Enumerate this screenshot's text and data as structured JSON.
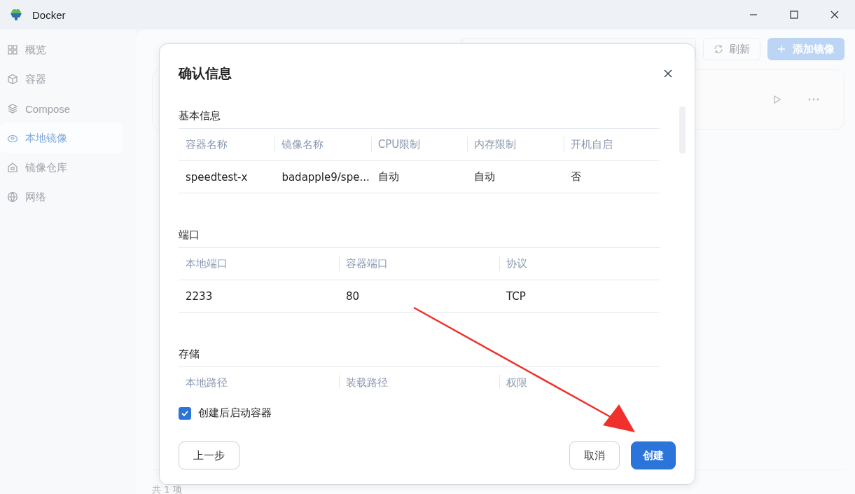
{
  "window": {
    "title": "Docker"
  },
  "sidebar": {
    "items": [
      {
        "label": "概览",
        "selected": false
      },
      {
        "label": "容器",
        "selected": false
      },
      {
        "label": "Compose",
        "selected": false
      },
      {
        "label": "本地镜像",
        "selected": true
      },
      {
        "label": "镜像仓库",
        "selected": false
      },
      {
        "label": "网络",
        "selected": false
      }
    ]
  },
  "toolbar": {
    "refresh": "刷新",
    "add": "添加镜像"
  },
  "footer": {
    "count": "共 1 项"
  },
  "dialog": {
    "title": "确认信息",
    "sections": [
      {
        "title": "基本信息",
        "columns": [
          "容器名称",
          "镜像名称",
          "CPU限制",
          "内存限制",
          "开机自启"
        ],
        "rows": [
          [
            "speedtest-x",
            "badapple9/spe...",
            "自动",
            "自动",
            "否"
          ]
        ]
      },
      {
        "title": "端口",
        "columns": [
          "本地端口",
          "容器端口",
          "协议"
        ],
        "rows": [
          [
            "2233",
            "80",
            "TCP"
          ]
        ]
      },
      {
        "title": "存储",
        "columns": [
          "本地路径",
          "装载路径",
          "权限"
        ]
      }
    ],
    "start_after_create": {
      "label": "创建后启动容器",
      "checked": true
    },
    "buttons": {
      "back": "上一步",
      "cancel": "取消",
      "create": "创建"
    }
  }
}
